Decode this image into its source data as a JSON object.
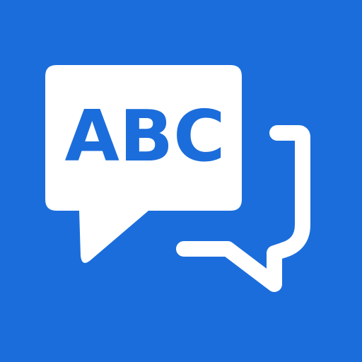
{
  "app_icon": {
    "name": "translate-chat-icon",
    "background_color": "#1b6ddb",
    "foreground_color": "#ffffff",
    "primary_bubble": {
      "icon": "filled-speech-bubble-icon",
      "text": "ABC"
    },
    "secondary_bubble": {
      "icon": "outline-speech-bubble-icon"
    }
  }
}
